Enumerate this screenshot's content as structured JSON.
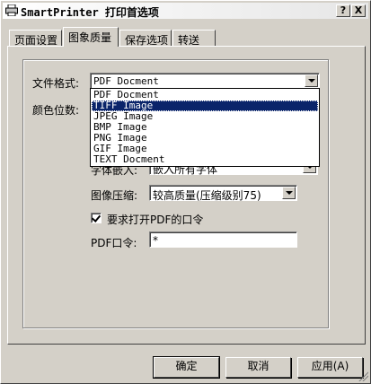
{
  "window": {
    "title": "SmartPrinter 打印首选项",
    "help_label": "?",
    "close_label": "X"
  },
  "tabs": [
    "页面设置",
    "图象质量",
    "保存选项",
    "转送"
  ],
  "form": {
    "file_format_label": "文件格式:",
    "file_format_value": "PDF Docment",
    "color_depth_label": "颜色位数:",
    "font_embed_label": "字体嵌入:",
    "font_embed_value": "嵌入所有字体",
    "image_compress_label": "图像压缩:",
    "image_compress_value": "较高质量(压缩级别75)",
    "require_password_label": "要求打开PDF的口令",
    "require_password_checked": true,
    "pdf_password_label": "PDF口令:",
    "pdf_password_value": "*"
  },
  "dropdown": {
    "options": [
      "PDF Docment",
      "TIFF Image",
      "JPEG Image",
      "BMP  Image",
      "PNG  Image",
      "GIF  Image",
      "TEXT Docment"
    ],
    "selected_index": 1
  },
  "buttons": {
    "ok": "确定",
    "cancel": "取消",
    "apply": "应用(A)"
  }
}
